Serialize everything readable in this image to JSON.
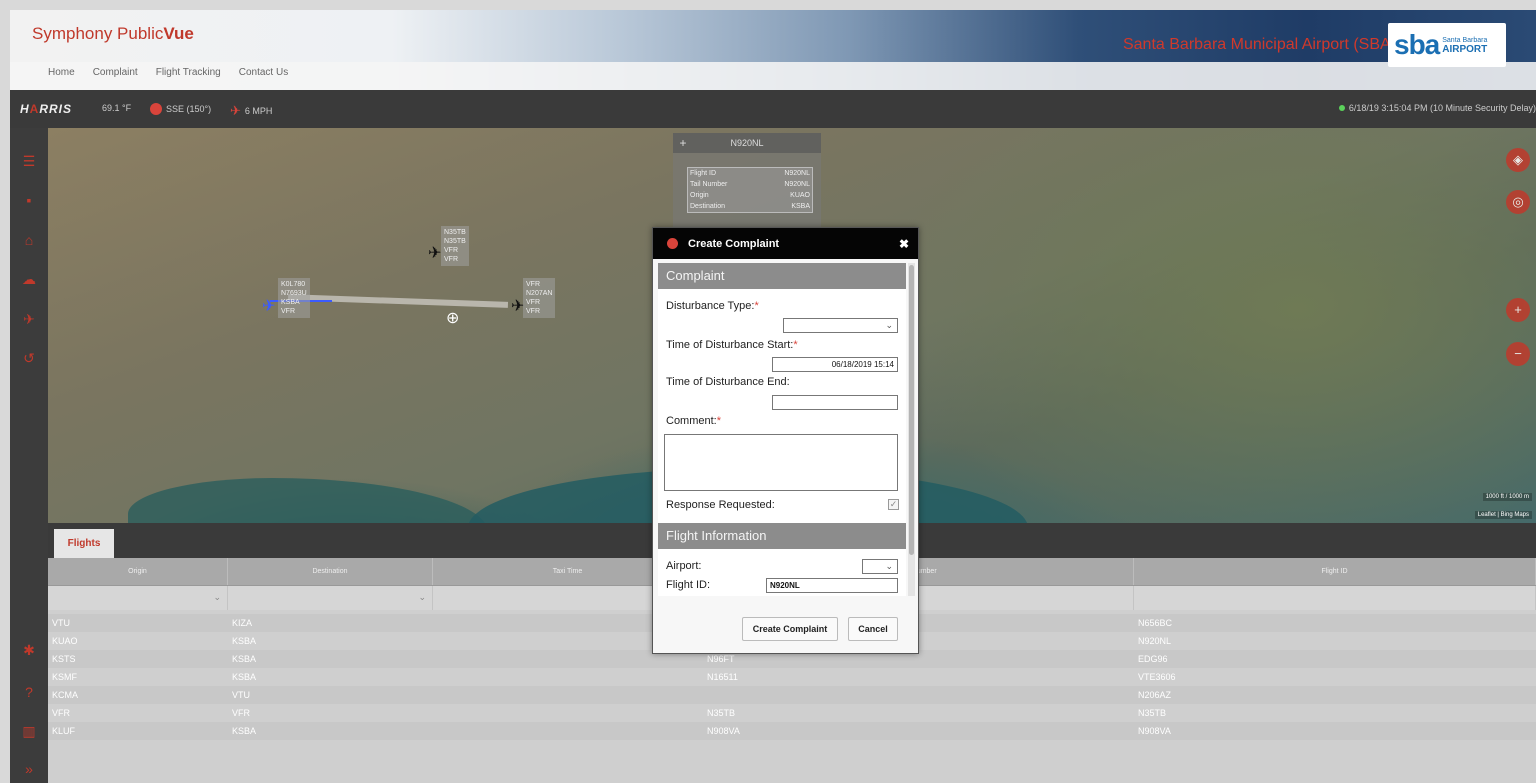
{
  "header": {
    "app_title_prefix": "Symphony Public",
    "app_title_suffix": "Vue",
    "nav": [
      "Home",
      "Complaint",
      "Flight Tracking",
      "Contact Us"
    ],
    "airport_name": "Santa Barbara Municipal Airport (SBA)",
    "logo_big": "sba",
    "logo_small_top": "Santa Barbara",
    "logo_small_bottom": "AIRPORT"
  },
  "weather": {
    "brand_a": "H",
    "brand_mark": "A",
    "brand_b": "RRIS",
    "temperature": "69.1 °F",
    "wind_direction": "SSE (150°)",
    "wind_speed": "6 MPH",
    "timestamp": "6/18/19 3:15:04 PM (10 Minute Security Delay)"
  },
  "map": {
    "aircraft_labels": [
      [
        "N35TB",
        "N35TB",
        "VFR",
        "VFR"
      ],
      [
        "K0L780",
        "N7693U",
        "KSBA",
        "VFR"
      ],
      [
        "VFR",
        "N207AN",
        "VFR",
        "VFR"
      ]
    ],
    "attribution": "Leaflet | Bing Maps",
    "scale_top": "1000 ft",
    "scale_bottom": "1000 m"
  },
  "popup": {
    "title": "N920NL",
    "rows": [
      [
        "Flight ID",
        "N920NL"
      ],
      [
        "Tail Number",
        "N920NL"
      ],
      [
        "Origin",
        "KUAO"
      ],
      [
        "Destination",
        "KSBA"
      ]
    ]
  },
  "dialog": {
    "title": "Create Complaint",
    "complaint_header": "Complaint",
    "disturbance_type_label": "Disturbance Type:",
    "disturbance_type_value": "",
    "start_label": "Time of Disturbance Start:",
    "start_value": "06/18/2019 15:14",
    "end_label": "Time of Disturbance End:",
    "end_value": "",
    "comment_label": "Comment:",
    "comment_value": "",
    "response_label": "Response Requested:",
    "flight_info_header": "Flight Information",
    "airport_label": "Airport:",
    "airport_value": "",
    "flight_id_label": "Flight ID:",
    "flight_id_value": "N920NL",
    "create_button": "Create Complaint",
    "cancel_button": "Cancel",
    "required_mark": "*"
  },
  "flights": {
    "tab_label": "Flights",
    "columns": [
      "Origin",
      "Destination",
      "Taxi Time",
      "Tail Number",
      "Flight ID"
    ],
    "rows": [
      [
        "VTU",
        "KIZA",
        "",
        "",
        "N656BC"
      ],
      [
        "KUAO",
        "KSBA",
        "",
        "",
        "N920NL"
      ],
      [
        "KSTS",
        "KSBA",
        "",
        "N96FT",
        "EDG96"
      ],
      [
        "KSMF",
        "KSBA",
        "",
        "N16511",
        "VTE3606"
      ],
      [
        "KCMA",
        "VTU",
        "",
        "",
        "N206AZ"
      ],
      [
        "VFR",
        "VFR",
        "",
        "N35TB",
        "N35TB"
      ],
      [
        "KLUF",
        "KSBA",
        "",
        "N908VA",
        "N908VA"
      ]
    ]
  },
  "colors": {
    "accent": "#c0392b",
    "dark_bar": "#3a3a3a",
    "section_header": "#8c8c8c"
  },
  "icons": {
    "sidebar": [
      "list-icon",
      "message-icon",
      "home-icon",
      "cloud-icon",
      "airplane-icon",
      "history-icon",
      "settings-icon",
      "help-icon",
      "columns-icon",
      "expand-icon"
    ],
    "map_controls": [
      "layers-icon",
      "locate-icon",
      "zoom-in-icon",
      "zoom-out-icon"
    ]
  }
}
